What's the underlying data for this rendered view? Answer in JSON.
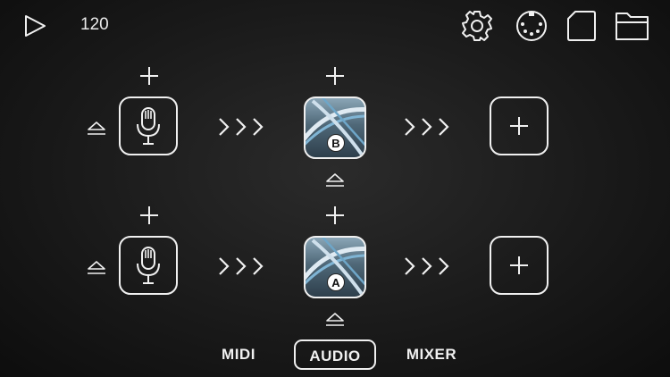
{
  "toolbar": {
    "tempo": "120",
    "icons": [
      "play-icon",
      "settings-gear-icon",
      "midi-port-icon",
      "sd-card-icon",
      "folder-icon"
    ]
  },
  "chains": [
    {
      "badge": "B",
      "input": "mic-icon",
      "effect": "plugin-eq",
      "output": "empty-slot"
    },
    {
      "badge": "A",
      "input": "mic-icon",
      "effect": "plugin-eq",
      "output": "empty-slot"
    }
  ],
  "tabs": [
    {
      "label": "MIDI",
      "active": false
    },
    {
      "label": "AUDIO",
      "active": true
    },
    {
      "label": "MIXER",
      "active": false
    }
  ],
  "colors": {
    "foreground": "#f0f0f0",
    "background": "#1a1a1a"
  }
}
